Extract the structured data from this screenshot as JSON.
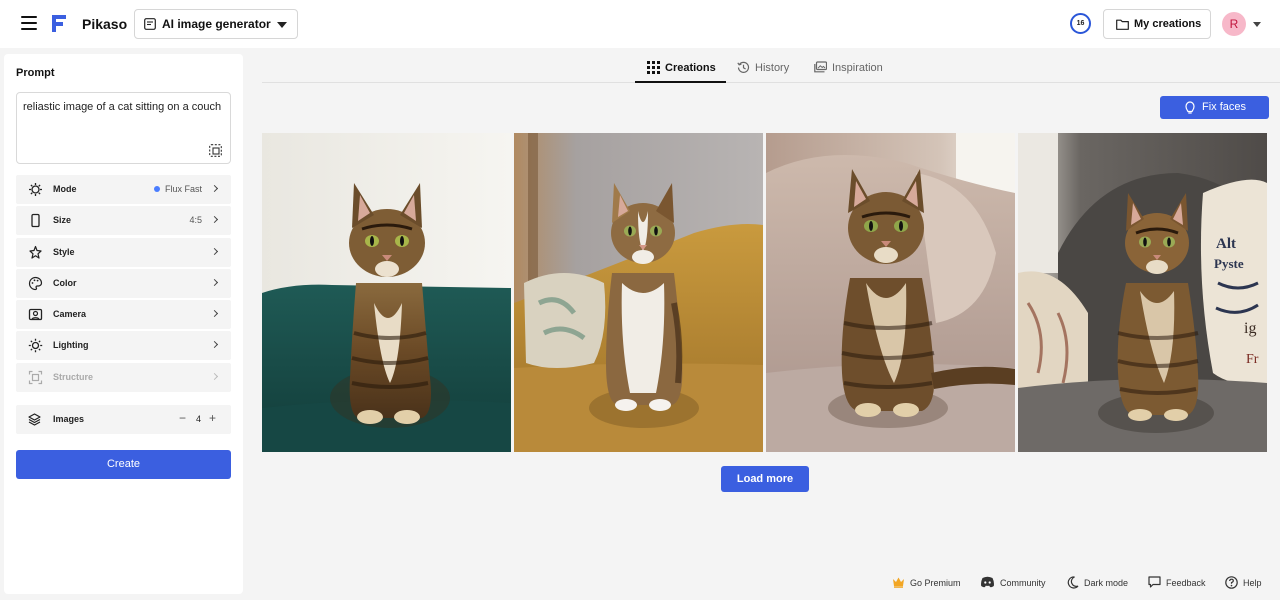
{
  "header": {
    "brand": "Pikaso",
    "tool_select": "AI image generator",
    "credits": "16",
    "my_creations": "My creations",
    "avatar_initial": "R"
  },
  "sidebar": {
    "prompt_title": "Prompt",
    "prompt_value": "reliastic image of a cat sitting on a couch",
    "settings": [
      {
        "label": "Mode",
        "value": "Flux Fast",
        "icon": "mode-icon"
      },
      {
        "label": "Size",
        "value": "4:5",
        "icon": "size-icon"
      },
      {
        "label": "Style",
        "value": "",
        "icon": "style-icon"
      },
      {
        "label": "Color",
        "value": "",
        "icon": "palette-icon"
      },
      {
        "label": "Camera",
        "value": "",
        "icon": "camera-icon"
      },
      {
        "label": "Lighting",
        "value": "",
        "icon": "lighting-icon"
      },
      {
        "label": "Structure",
        "value": "",
        "icon": "structure-icon"
      }
    ],
    "images": {
      "label": "Images",
      "count": "4",
      "minus": "−",
      "plus": "+"
    },
    "create_label": "Create"
  },
  "tabs": [
    {
      "label": "Creations",
      "active": true,
      "icon": "grid-icon"
    },
    {
      "label": "History",
      "active": false,
      "icon": "history-icon"
    },
    {
      "label": "Inspiration",
      "active": false,
      "icon": "inspiration-icon"
    }
  ],
  "fix_faces": "Fix faces",
  "load_more": "Load more",
  "footer": {
    "go_premium": "Go Premium",
    "community": "Community",
    "dark_mode": "Dark mode",
    "feedback": "Feedback",
    "help": "Help"
  },
  "colors": {
    "accent": "#3b5fe0",
    "avatar_bg": "#f7b8c9",
    "mode_dot": "#4a7dff"
  }
}
